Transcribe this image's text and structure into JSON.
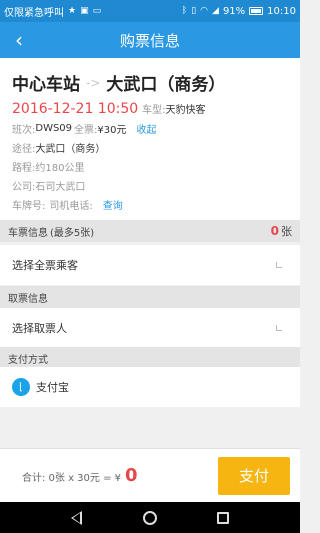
{
  "status_bar": {
    "emergency_text": "仅限紧急呼叫",
    "battery_percent": "91%",
    "time": "10:10",
    "icons": [
      "star-icon",
      "sim-icon",
      "photo-icon",
      "bluetooth-icon",
      "vibrate-icon",
      "wifi-icon",
      "signal-icon",
      "battery-icon"
    ]
  },
  "header": {
    "back_icon": "chevron-left-icon",
    "title": "购票信息"
  },
  "trip": {
    "from": "中心车站",
    "arrow": "->",
    "to": "大武口（商务）",
    "departure": "2016-12-21 10:50",
    "car_type_label": "车型:",
    "car_type": "天豹快客",
    "shift_label": "班次:",
    "shift": "DWS09",
    "fare_label": "全票:",
    "fare": "¥30元",
    "collapse_link": "收起",
    "via_label": "途径:",
    "via": "大武口（商务）",
    "route_label": "路程:",
    "route": "约180公里",
    "company_label": "公司:",
    "company": "石司大武口",
    "plate_label": "车牌号:",
    "driver_label": "司机电话:",
    "query_link": "查询"
  },
  "ticket_section": {
    "header": "车票信息",
    "limit": "(最多5张)",
    "count": "0",
    "count_unit": "张",
    "select_passenger": "选择全票乘客"
  },
  "pickup_section": {
    "header": "取票信息",
    "select_person": "选择取票人"
  },
  "payment_section": {
    "header": "支付方式",
    "method_icon": "alipay-icon",
    "method": "支付宝"
  },
  "footer": {
    "total_text": "合计: 0张 x 30元 = ¥",
    "total_amount": "0",
    "pay_button": "支付"
  },
  "colors": {
    "accent": "#2a98e2",
    "price_red": "#e8474a",
    "pay_button": "#f7b512"
  }
}
